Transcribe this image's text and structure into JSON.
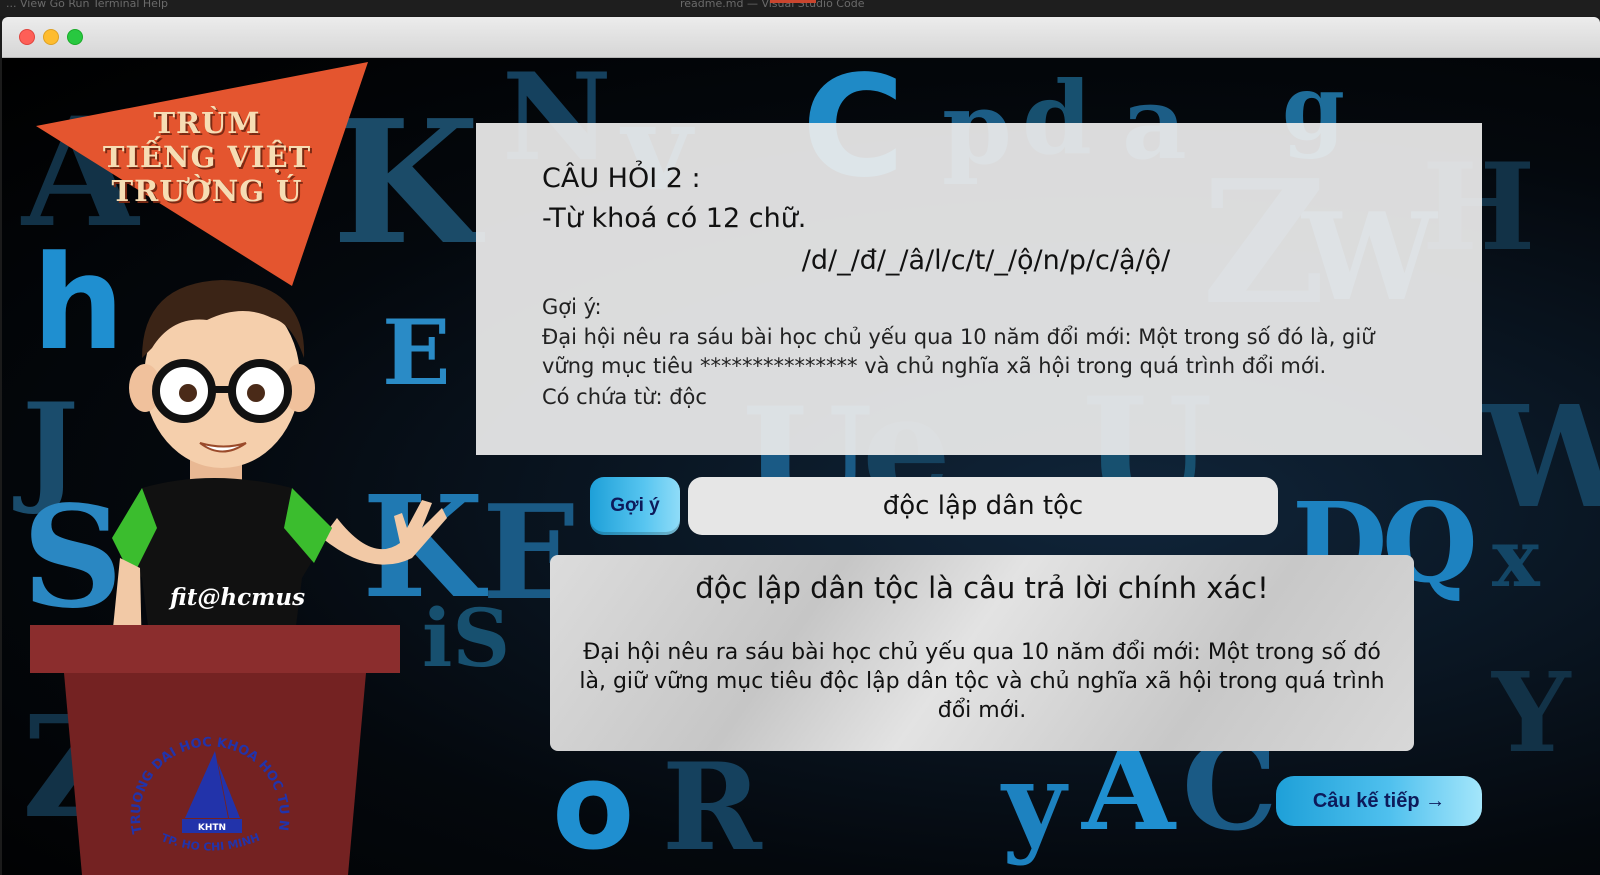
{
  "os_menubar": {
    "menu_text": "... View  Go  Run  Terminal  Help",
    "window_title": "readme.md — Visual Studio Code"
  },
  "window": {
    "controls": [
      "close",
      "minimize",
      "maximize"
    ]
  },
  "banner": {
    "line1": "TRÙM",
    "line2": "TIẾNG VIỆT",
    "line3": "TRƯỜNG Ú",
    "color": "#e4552f"
  },
  "character": {
    "shirt_text": "fit@hcmus"
  },
  "podium": {
    "seal_top_text": "TRUONG DAI HOC KHOA HOC TU NHIEN",
    "seal_bottom_text": "TP. HO CHI MINH",
    "seal_center_text": "KHTN"
  },
  "question": {
    "title": "CÂU HỎI 2 :",
    "letter_count": "-Từ khoá có 12 chữ.",
    "pattern": "/d/_/đ/_/â/l/c/t/_/ộ/n/p/c/ậ/ộ/",
    "hint_label": "Gợi ý:",
    "hint_text": "Đại hội nêu ra sáu bài học chủ yếu qua 10 năm đổi mới: Một trong số đó là, giữ vững mục tiêu *************** và chủ nghĩa xã hội trong quá trình đổi mới.",
    "contains_text": "Có chứa từ: độc"
  },
  "controls": {
    "hint_button_label": "Gợi ý",
    "answer_value": "độc lập dân tộc",
    "next_button_label": "Câu kế tiếp →"
  },
  "result": {
    "title": "độc lập dân tộc là câu trả lời chính xác!",
    "explanation": "Đại hội nêu ra sáu bài học chủ yếu qua 10 năm đổi mới: Một trong số đó là, giữ vững mục tiêu độc lập dân tộc và chủ nghĩa xã hội trong quá trình đổi mới."
  },
  "colors": {
    "accent_blue": "#2aa6dd",
    "button_text": "#0d1a5a",
    "podium": "#7a2525"
  }
}
